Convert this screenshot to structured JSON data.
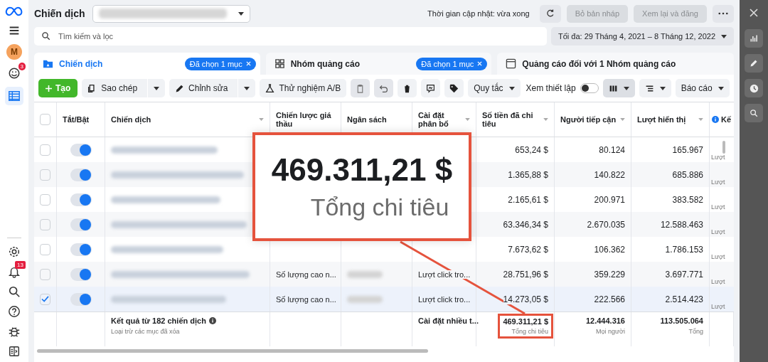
{
  "header": {
    "title": "Chiến dịch",
    "update_status": "Thời gian cập nhật: vừa xong",
    "buttons": [
      {
        "label": "Bỏ bản nháp",
        "disabled": true
      },
      {
        "label": "Xem lại và đăng",
        "disabled": true
      }
    ]
  },
  "sidebar": {
    "avatar": "M",
    "alerts_badge": "3",
    "notifications_badge": "13"
  },
  "search": {
    "placeholder": "Tìm kiếm và lọc"
  },
  "date_range": "Tối đa: 29 Tháng 4, 2021 – 8 Tháng 12, 2022",
  "tabs": [
    {
      "label": "Chiến dịch",
      "selected": true,
      "chip": "Đã chọn 1 mục"
    },
    {
      "label": "Nhóm quảng cáo",
      "selected": false,
      "chip": "Đã chọn 1 mục"
    },
    {
      "label": "Quảng cáo đối với 1 Nhóm quảng cáo",
      "selected": false
    }
  ],
  "toolbar": {
    "create": "Tạo",
    "copy": "Sao chép",
    "edit": "Chỉnh sửa",
    "ab_test": "Thử nghiệm A/B",
    "rules": "Quy tắc",
    "view_setup": {
      "label": "Xem thiết lập",
      "on": false
    },
    "reports": "Báo cáo"
  },
  "table": {
    "all_selected": false,
    "columns": [
      "Tắt/Bật",
      "Chiến dịch",
      "Chiến lược giá thầu",
      "Ngân sách",
      "Cài đặt phân bổ",
      "Số tiền đã chi tiêu",
      "Người tiếp cận",
      "Lượt hiển thị",
      "Kế"
    ],
    "rows": [
      {
        "selected": false,
        "on": true,
        "spend": "653,24 $",
        "reach": "80.124",
        "impressions": "165.967",
        "column_10": "Lượt"
      },
      {
        "selected": false,
        "on": true,
        "spend": "1.365,88 $",
        "reach": "140.822",
        "impressions": "685.886",
        "column_10": "Lượt"
      },
      {
        "selected": false,
        "on": true,
        "spend": "2.165,61 $",
        "reach": "200.971",
        "impressions": "383.582",
        "column_10": "Lượt"
      },
      {
        "selected": false,
        "on": true,
        "spend": "63.346,34 $",
        "reach": "2.670.035",
        "impressions": "12.588.463",
        "column_10": "Lượt"
      },
      {
        "selected": false,
        "on": true,
        "spend": "7.673,62 $",
        "reach": "106.362",
        "impressions": "1.786.153",
        "column_10": "Lượt"
      },
      {
        "selected": false,
        "on": true,
        "bid_strategy": "Số lượng cao n...",
        "attribution": "Lượt click tro...",
        "spend": "28.751,96 $",
        "reach": "359.229",
        "impressions": "3.697.771",
        "column_10": "Lượt"
      },
      {
        "selected": true,
        "on": true,
        "bid_strategy": "Số lượng cao n...",
        "attribution": "Lượt click tro...",
        "spend": "14.273,05 $",
        "reach": "222.566",
        "impressions": "2.514.423",
        "column_10": "Lượt"
      }
    ],
    "footer": {
      "label": "Kết quả từ 182 chiến dịch",
      "note": "Loại trừ các mục đã xóa",
      "attribution": "Cài đặt nhiều t...",
      "spend": "469.311,21 $",
      "spend_label": "Tổng chi tiêu",
      "reach": "12.444.316",
      "reach_label": "Mọi người",
      "impressions": "113.505.064",
      "impressions_label": "Tổng"
    }
  },
  "callout": {
    "value": "469.311,21 $",
    "label": "Tổng chi tiêu"
  }
}
